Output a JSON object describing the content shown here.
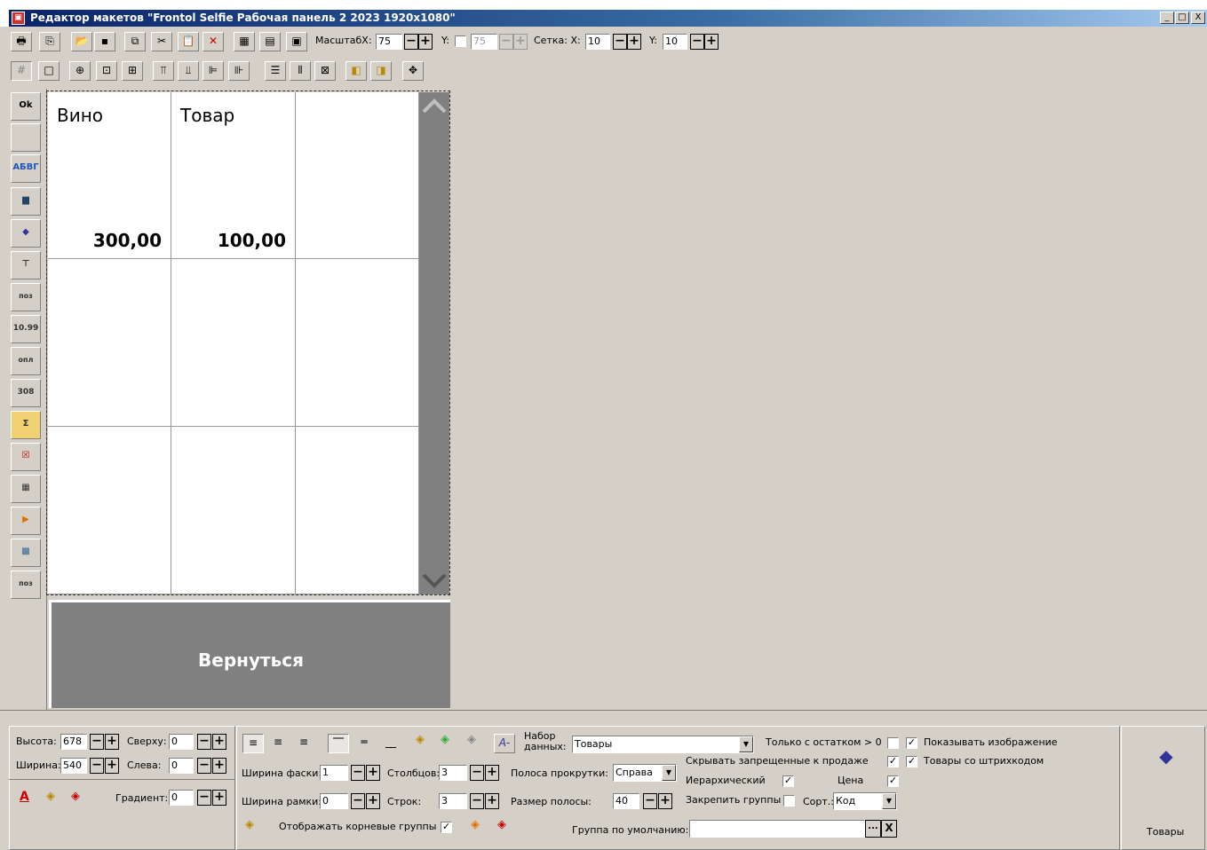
{
  "window": {
    "title": "Редактор макетов \"Frontol Selfie Рабочая панель 2 2023 1920x1080\"",
    "controls": [
      "_",
      "□",
      "X"
    ]
  },
  "toolbar": {
    "scale_label": "МасштабХ:",
    "scale_x": "75",
    "y_label": "Y:",
    "scale_y": "75",
    "grid_label": "Сетка: X:",
    "grid_x": "10",
    "grid_y_label": "Y:",
    "grid_y": "10"
  },
  "left_tools": [
    "Ok",
    "",
    "АБВГ",
    "",
    "",
    "",
    "поз",
    "10.99",
    "опл",
    "308",
    "Σ",
    "",
    "",
    "",
    "",
    "поз"
  ],
  "canvas": {
    "cells": [
      {
        "name": "Вино",
        "price": "300,00"
      },
      {
        "name": "Товар",
        "price": "100,00"
      },
      {
        "name": "",
        "price": ""
      },
      {
        "name": "",
        "price": ""
      },
      {
        "name": "",
        "price": ""
      },
      {
        "name": "",
        "price": ""
      },
      {
        "name": "",
        "price": ""
      },
      {
        "name": "",
        "price": ""
      },
      {
        "name": "",
        "price": ""
      }
    ],
    "back_button": "Вернуться",
    "scroll_up": "︿",
    "scroll_down": "﹀"
  },
  "props": {
    "height_label": "Высота:",
    "height": "678",
    "top_label": "Сверху:",
    "top": "0",
    "width_label": "Ширина:",
    "width": "540",
    "left_label": "Слева:",
    "left": "0",
    "gradient_label": "Градиент:",
    "gradient": "0",
    "dataset_label": "Набор данных:",
    "dataset": "Товары",
    "bevel_label": "Ширина фаски:",
    "bevel": "1",
    "cols_label": "Столбцов:",
    "cols": "3",
    "scroll_label": "Полоса прокрутки:",
    "scroll": "Справа",
    "border_label": "Ширина рамки:",
    "border": "0",
    "rows_label": "Строк:",
    "rows": "3",
    "bar_size_label": "Размер полосы:",
    "bar_size": "40",
    "show_root_label": "Отображать корневые группы",
    "default_group_label": "Группа по умолчанию:",
    "default_group": "",
    "only_stock_label": "Только с остатком > 0",
    "show_image_label": "Показывать изображение",
    "hide_forbidden_label": "Скрывать запрещенные к продаже",
    "barcode_label": "Товары со штрихкодом",
    "hier_label": "Иерархический",
    "price_label": "Цена",
    "pin_groups_label": "Закрепить группы",
    "sort_label": "Сорт.:",
    "sort": "Код",
    "browse_btn": "...",
    "clear_btn": "X",
    "preview_label": "Товары"
  }
}
